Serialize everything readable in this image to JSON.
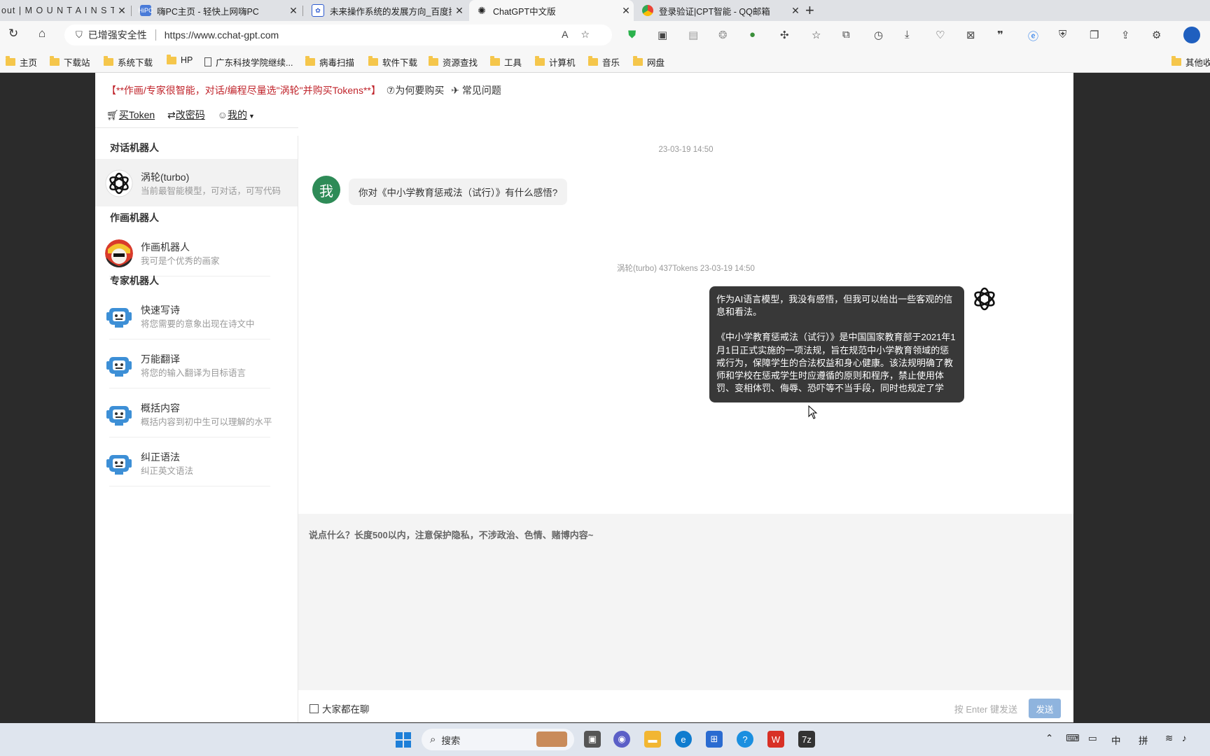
{
  "browser": {
    "tabs": [
      {
        "title": "out | M O U N T A I N S T U D"
      },
      {
        "title": "嗨PC主页 - 轻快上网嗨PC"
      },
      {
        "title": "未来操作系统的发展方向_百度搜"
      },
      {
        "title": "ChatGPT中文版"
      },
      {
        "title": "登录验证|CPT智能 - QQ邮箱"
      }
    ],
    "security_label": "已增强安全性",
    "url": "https://www.cchat-gpt.com",
    "bookmarks": [
      "主页",
      "下载站",
      "系统下载",
      "HP",
      "广东科技学院继续...",
      "病毒扫描",
      "软件下载",
      "资源查找",
      "工具",
      "计算机",
      "音乐",
      "网盘",
      "其他收"
    ]
  },
  "page": {
    "notice_prefix": "【",
    "notice_red": "**作画/专家很智能，对话/编程尽量选\"涡轮\"并购买Tokens**",
    "notice_suffix": "】",
    "why_buy": "⑦为何要购买",
    "faq": "常见问题",
    "buy_token": "买Token",
    "change_password": "改密码",
    "my": "我的"
  },
  "sidebar": {
    "section_chat": "对话机器人",
    "section_draw": "作画机器人",
    "section_expert": "专家机器人",
    "chat_bots": [
      {
        "name": "涡轮(turbo)",
        "desc": "当前最智能模型，可对话，可写代码"
      }
    ],
    "draw_bots": [
      {
        "name": "作画机器人",
        "desc": "我可是个优秀的画家"
      }
    ],
    "expert_bots": [
      {
        "name": "快速写诗",
        "desc": "将您需要的意象出现在诗文中"
      },
      {
        "name": "万能翻译",
        "desc": "将您的输入翻译为目标语言"
      },
      {
        "name": "概括内容",
        "desc": "概括内容到初中生可以理解的水平"
      },
      {
        "name": "纠正语法",
        "desc": "纠正英文语法"
      }
    ]
  },
  "chat": {
    "user_time": "23-03-19 14:50",
    "user_avatar_char": "我",
    "user_message": "你对《中小学教育惩戒法（试行）》有什么感悟?",
    "bot_meta": "涡轮(turbo) 437Tokens 23-03-19 14:50",
    "bot_paragraphs": [
      "作为AI语言模型，我没有感悟，但我可以给出一些客观的信息和看法。",
      "《中小学教育惩戒法（试行）》是中国国家教育部于2021年1月1日正式实施的一项法规，旨在规范中小学教育领域的惩戒行为，保障学生的合法权益和身心健康。该法规明确了教师和学校在惩戒学生时应遵循的原则和程序，禁止使用体罚、变相体罚、侮辱、恐吓等不当手段，同时也规定了学"
    ]
  },
  "input": {
    "placeholder": "说点什么？长度500以内，注意保护隐私，不涉政治、色情、赌博内容~",
    "everyone_chatting": "大家都在聊",
    "send_hint": "按 Enter 键发送",
    "send_label": "发送"
  },
  "taskbar": {
    "search_label": "搜索",
    "ime_lang": "中",
    "ime_mode": "拼"
  }
}
